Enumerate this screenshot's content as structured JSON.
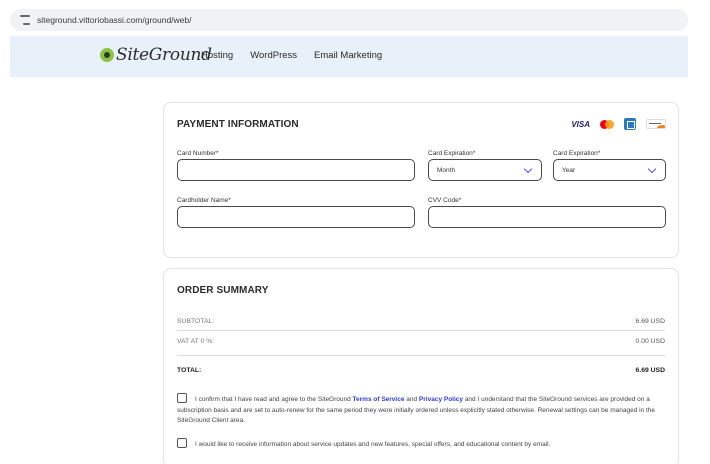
{
  "browser": {
    "url": "siteground.vittoriobassi.com/ground/web/"
  },
  "header": {
    "logo_text": "SiteGround",
    "nav": [
      "Hosting",
      "WordPress",
      "Email Marketing"
    ]
  },
  "payment": {
    "title": "PAYMENT INFORMATION",
    "card_logos": [
      "VISA",
      "mastercard-icon",
      "amex-icon",
      "discover-icon"
    ],
    "card_number_label": "Card Number*",
    "card_number_value": "",
    "expiration_label_1": "Card Expiration*",
    "expiration_month_value": "Month",
    "expiration_label_2": "Card Expiration*",
    "expiration_year_value": "Year",
    "cardholder_label": "Cardholder Name*",
    "cardholder_value": "",
    "cvv_label": "CVV Code*",
    "cvv_value": ""
  },
  "summary": {
    "title": "ORDER SUMMARY",
    "subtotal_label": "SUBTOTAL:",
    "subtotal_value": "6.69 USD",
    "vat_label": "VAT AT 0 %:",
    "vat_value": "0.00 USD",
    "total_label": "TOTAL:",
    "total_value": "6.69 USD"
  },
  "consent": {
    "terms_prefix": "I confirm that I have read and agree to the SiteGround ",
    "terms_link": "Terms of Service",
    "terms_and": " and ",
    "privacy_link": "Privacy Policy",
    "terms_suffix": " and I understand that the SiteGround services are provided on a subscription basis and are set to auto-renew for the same period they were initially ordered unless explicitly stated otherwise. Renewal settings can be managed in the SiteGround Client area.",
    "marketing_text": "I would like to receive information about service updates and new features, special offers, and educational content by email."
  },
  "colors": {
    "header_bg": "#e8f0fa",
    "link": "#2f3bd8",
    "chevron": "#5b4fe0",
    "logo_green": "#8bc34a"
  }
}
